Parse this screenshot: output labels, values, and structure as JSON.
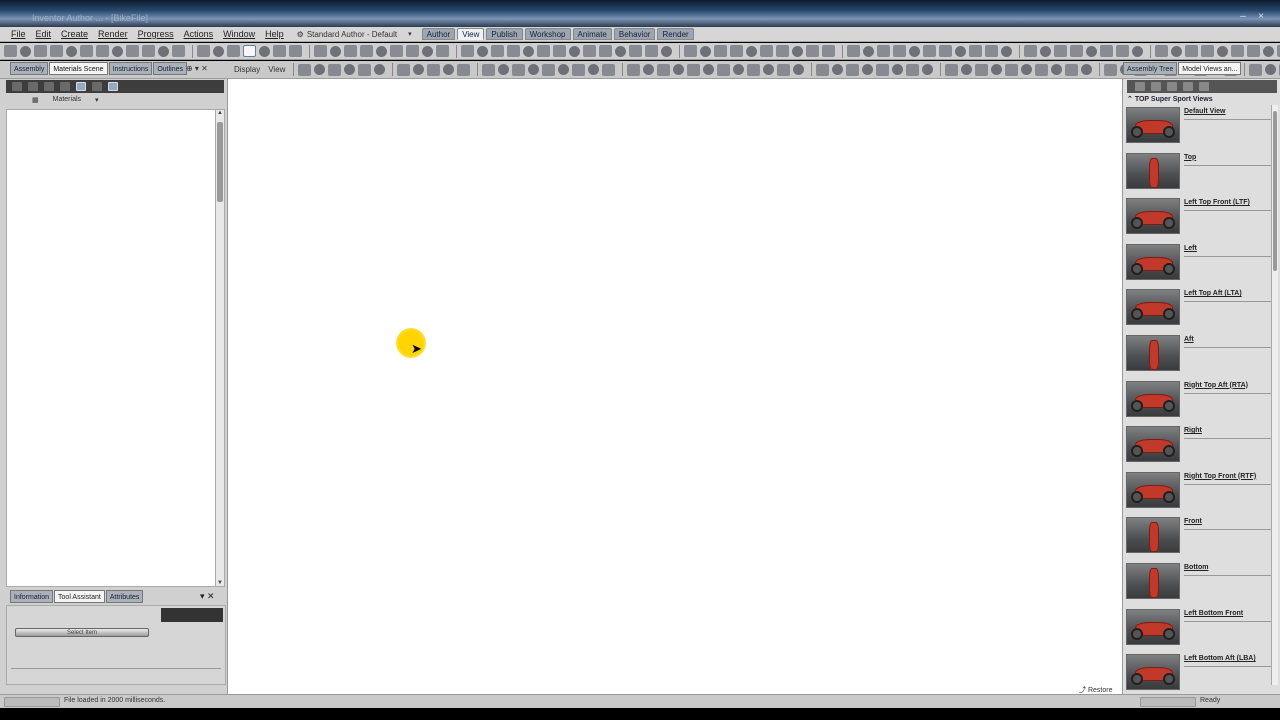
{
  "titlebar": {
    "title": "Inventor Author ... - [BikeFile]"
  },
  "menu": {
    "items": [
      "File",
      "Edit",
      "Create",
      "Render",
      "Progress",
      "Actions",
      "Window",
      "Help"
    ],
    "layout": "Standard Author - Default",
    "mode_tabs": [
      "Author",
      "View",
      "Publish",
      "Workshop",
      "Animate",
      "Behavior",
      "Render"
    ]
  },
  "toolbar2": {
    "display_label": "Display",
    "view_label": "View"
  },
  "left_panel": {
    "tabs": [
      "Assembly",
      "Materials Scene",
      "Instructions",
      "Outlines"
    ],
    "active_tab": "Materials Scene",
    "path_items": [
      "Materials"
    ],
    "bottom_tabs": [
      "Information",
      "Tool Assistant",
      "Attributes"
    ],
    "bottom_button": "Select Item"
  },
  "right_panel": {
    "tabs": [
      "Assembly Tree",
      "Model Views an..."
    ],
    "header": "TOP Super Sport Views",
    "views": [
      {
        "label": "Default View",
        "thumb": "side"
      },
      {
        "label": "Top",
        "thumb": "narrow"
      },
      {
        "label": "Left Top Front (LTF)",
        "thumb": "side"
      },
      {
        "label": "Left",
        "thumb": "side"
      },
      {
        "label": "Left Top Aft (LTA)",
        "thumb": "side"
      },
      {
        "label": "Aft",
        "thumb": "narrow"
      },
      {
        "label": "Right Top Aft (RTA)",
        "thumb": "side"
      },
      {
        "label": "Right",
        "thumb": "side"
      },
      {
        "label": "Right Top Front (RTF)",
        "thumb": "side"
      },
      {
        "label": "Front",
        "thumb": "narrow"
      },
      {
        "label": "Bottom",
        "thumb": "narrow"
      },
      {
        "label": "Left Bottom Front",
        "thumb": "side"
      },
      {
        "label": "Left Bottom Aft (LBA)",
        "thumb": "side"
      }
    ],
    "footer": "Restore"
  },
  "status": {
    "message": "File loaded in 2000 milliseconds.",
    "right": "Ready"
  },
  "colors": {
    "cursor_highlight": "#ffd400",
    "bike_body": "#c0392b"
  }
}
